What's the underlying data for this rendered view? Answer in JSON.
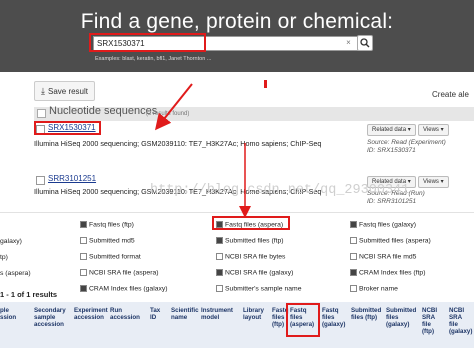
{
  "banner": {
    "title": "Find a gene, protein or chemical:",
    "search_value": "SRX1530371",
    "clear_symbol": "×",
    "examples": "Examples: blast, keratin, bfl1, Janet Thornton ..."
  },
  "toolbar": {
    "save_label": "Save result",
    "create_alert": "Create ale"
  },
  "section": {
    "title": "Nucleotide sequences",
    "count": "(2 results found)"
  },
  "results": [
    {
      "id": "SRX1530371",
      "description": "Illumina HiSeq 2000 sequencing; GSM2039110: TE7_H3K27Ac; Homo sapiens; ChIP-Seq",
      "related": "Related data ▾",
      "views": "Views ▾",
      "source": "Source: Read (Experiment)",
      "source_id": "ID: SRX1530371"
    },
    {
      "id": "SRR3101251",
      "description": "Illumina HiSeq 2000 sequencing; GSM2039110: TE7_H3K27Ac; Homo sapiens; ChIP-Seq",
      "related": "Related data ▾",
      "views": "Views ▾",
      "source": "Source: Read (Run)",
      "source_id": "ID: SRR3101251"
    }
  ],
  "watermark": "http://blog.csdn.net/qq_29300341",
  "options": {
    "col0": [
      "galaxy)",
      "tp)",
      "s (aspera)"
    ],
    "col1": [
      "Fastq files (ftp)",
      "Submitted md5",
      "Submitted format",
      "NCBI SRA file (aspera)",
      "CRAM Index files (galaxy)"
    ],
    "col2": [
      "Fastq files (aspera)",
      "Submitted files (ftp)",
      "NCBI SRA file bytes",
      "NCBI SRA file (galaxy)",
      "Submitter's sample name"
    ],
    "col3": [
      "Fastq files (galaxy)",
      "Submitted files (aspera)",
      "NCBI SRA file md5",
      "CRAM Index files (ftp)",
      "Broker name"
    ],
    "checked": {
      "col1": [
        true,
        false,
        false,
        false,
        true
      ],
      "col2": [
        true,
        true,
        false,
        true,
        false
      ],
      "col3": [
        true,
        false,
        false,
        true,
        false
      ]
    }
  },
  "results_count": "1 - 1 of 1 results",
  "table_headers": [
    "ple\nssion",
    "Secondary\nsample\naccession",
    "Experiment\naccession",
    "Run\naccession",
    "Tax\nID",
    "Scientific\nname",
    "Instrument\nmodel",
    "Library\nlayout",
    "Fastq\nfiles\n(ftp)",
    "Fastq\nfiles\n(aspera)",
    "Fastq\nfiles\n(galaxy)",
    "Submitted\nfiles (ftp)",
    "Submitted\nfiles\n(galaxy)",
    "NCBI\nSRA\nfile\n(ftp)",
    "NCBI\nSRA\nfile\n(galaxy)"
  ],
  "colors": {
    "banner_bg": "#4d4d4d",
    "highlight_red": "#e01b1b",
    "link_blue": "#1a3a8f",
    "header_bg": "#e8edf5"
  }
}
